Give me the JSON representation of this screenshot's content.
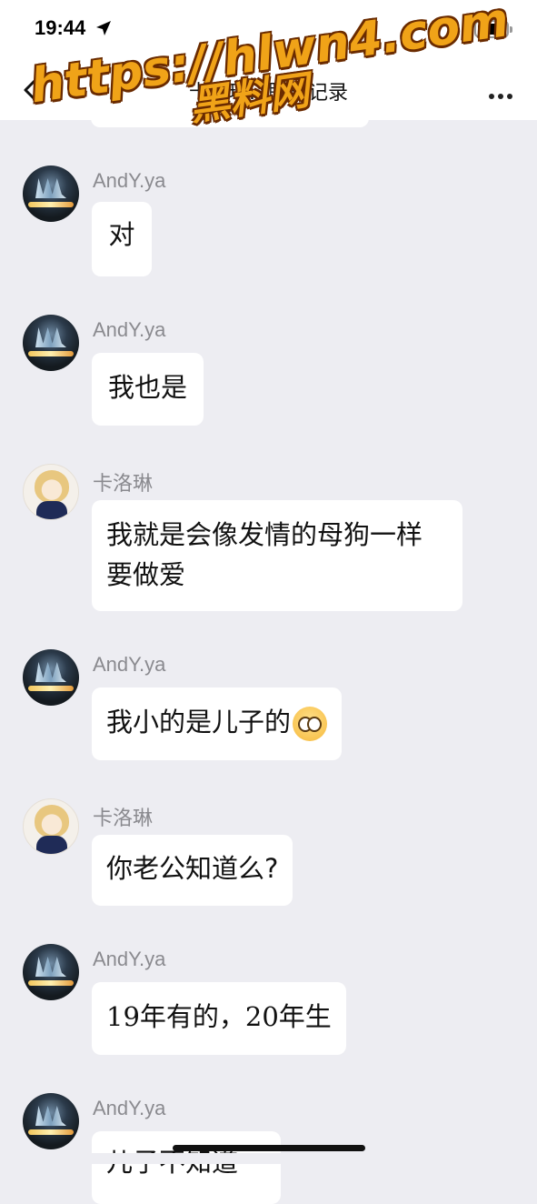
{
  "status_bar": {
    "time": "19:44"
  },
  "nav": {
    "title": "卡洛琳...聊天记录",
    "back_icon": "chevron-left-icon",
    "more_icon": "more-dots-icon"
  },
  "watermark": {
    "url": "https://hlwn4.com",
    "label": "黑料网"
  },
  "messages": [
    {
      "sender": "AndY.ya",
      "avatar": "andy",
      "text": "对"
    },
    {
      "sender": "AndY.ya",
      "avatar": "andy",
      "text": "我也是"
    },
    {
      "sender": "卡洛琳",
      "avatar": "carolyn",
      "text": "我就是会像发情的母狗一样要做爱"
    },
    {
      "sender": "AndY.ya",
      "avatar": "andy",
      "text": "我小的是儿子的",
      "emoji": "pleading-face-emoji"
    },
    {
      "sender": "卡洛琳",
      "avatar": "carolyn",
      "text": "你老公知道么?"
    },
    {
      "sender": "AndY.ya",
      "avatar": "andy",
      "text": "19年有的，20年生"
    },
    {
      "sender": "AndY.ya",
      "avatar": "andy",
      "text": "儿子不知道"
    }
  ],
  "colors": {
    "background": "#ededf2",
    "bubble": "#ffffff",
    "sender_name": "#8a8a8f",
    "watermark_fill": "#f0a318",
    "watermark_outline": "#6a2b00"
  }
}
